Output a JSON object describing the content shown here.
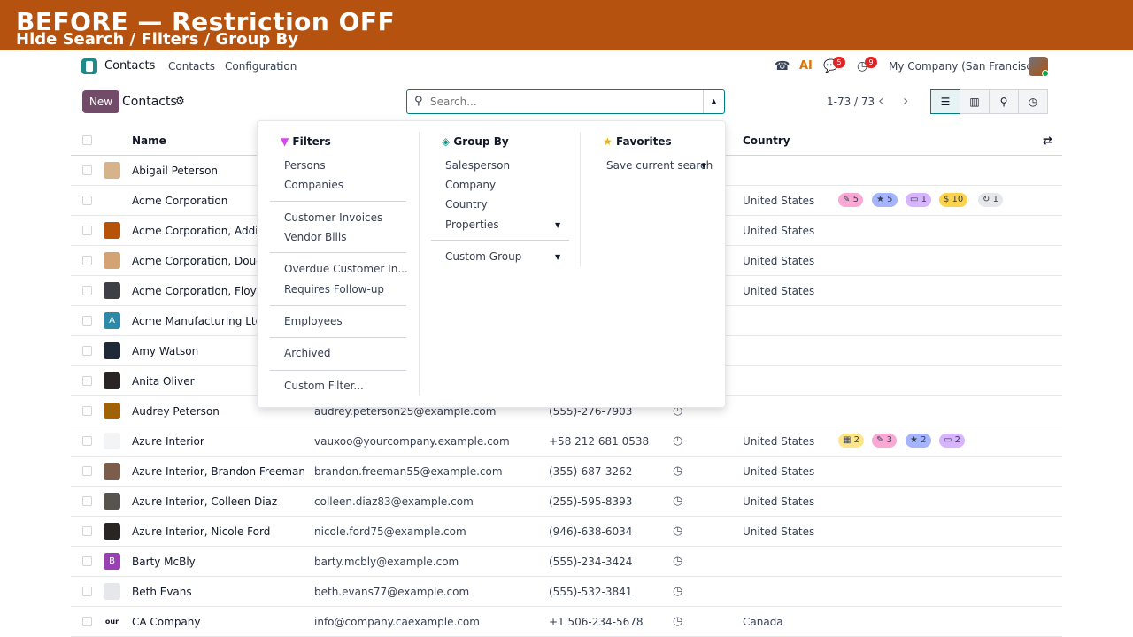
{
  "banner": {
    "title": "BEFORE — Restriction OFF",
    "subtitle": "Hide Search / Filters / Group By"
  },
  "navbar": {
    "app_name": "Contacts",
    "menu": [
      "Contacts",
      "Configuration"
    ],
    "messages_count": "5",
    "activities_count": "9",
    "company": "My Company (San Francisco)"
  },
  "control": {
    "new_label": "New",
    "title": "Contacts",
    "search_placeholder": "Search...",
    "pager": "1-73 / 73"
  },
  "table": {
    "headers": {
      "name": "Name",
      "country": "Country"
    },
    "rows": [
      {
        "name": "Abigail Peterson",
        "email": "",
        "phone": "",
        "country": "",
        "av_color": "#d6b38a"
      },
      {
        "name": "Acme Corporation",
        "email": "",
        "phone": "",
        "country": "United States",
        "av_color": "#ffffff"
      },
      {
        "name": "Acme Corporation, Addison",
        "email": "",
        "phone": "",
        "country": "United States",
        "av_color": "#b45309"
      },
      {
        "name": "Acme Corporation, Douglas",
        "email": "",
        "phone": "",
        "country": "United States",
        "av_color": "#d4a373"
      },
      {
        "name": "Acme Corporation, Floyd St",
        "email": "",
        "phone": "",
        "country": "United States",
        "av_color": "#3f3f46"
      },
      {
        "name": "Acme Manufacturing Ltd",
        "email": "",
        "phone": "",
        "country": "",
        "av_color": "#2c8aa8",
        "initial": "A"
      },
      {
        "name": "Amy Watson",
        "email": "",
        "phone": "",
        "country": "",
        "av_color": "#1f2937"
      },
      {
        "name": "Anita Oliver",
        "email": "",
        "phone": "",
        "country": "",
        "av_color": "#292524"
      },
      {
        "name": "Audrey Peterson",
        "email": "audrey.peterson25@example.com",
        "phone": "(555)-276-7903",
        "country": "",
        "av_color": "#a16207"
      },
      {
        "name": "Azure Interior",
        "email": "vauxoo@yourcompany.example.com",
        "phone": "+58 212 681 0538",
        "country": "United States",
        "av_color": "#f3f4f6"
      },
      {
        "name": "Azure Interior, Brandon Freeman",
        "email": "brandon.freeman55@example.com",
        "phone": "(355)-687-3262",
        "country": "United States",
        "av_color": "#7c5c4a"
      },
      {
        "name": "Azure Interior, Colleen Diaz",
        "email": "colleen.diaz83@example.com",
        "phone": "(255)-595-8393",
        "country": "United States",
        "av_color": "#57534e"
      },
      {
        "name": "Azure Interior, Nicole Ford",
        "email": "nicole.ford75@example.com",
        "phone": "(946)-638-6034",
        "country": "United States",
        "av_color": "#292524"
      },
      {
        "name": "Barty McBly",
        "email": "barty.mcbly@example.com",
        "phone": "(555)-234-3424",
        "country": "",
        "av_color": "#9b3fb5",
        "initial": "B"
      },
      {
        "name": "Beth Evans",
        "email": "beth.evans77@example.com",
        "phone": "(555)-532-3841",
        "country": "",
        "av_color": "#e5e7eb"
      },
      {
        "name": "CA Company",
        "email": "info@company.caexample.com",
        "phone": "+1 506-234-5678",
        "country": "Canada",
        "av_color": "#ffffff",
        "initial": "our l"
      }
    ],
    "acme_tags": [
      "5",
      "5",
      "1",
      "$ 10",
      "1"
    ],
    "azure_tags": [
      "2",
      "3",
      "2",
      "2"
    ]
  },
  "dropdown": {
    "filters_title": "Filters",
    "filters": [
      "Persons",
      "Companies",
      "Customer Invoices",
      "Vendor Bills",
      "Overdue Customer In...",
      "Requires Follow-up",
      "Employees",
      "Archived",
      "Custom Filter..."
    ],
    "groupby_title": "Group By",
    "groupby": [
      "Salesperson",
      "Company",
      "Country",
      "Properties",
      "Custom Group"
    ],
    "favorites_title": "Favorites",
    "favorites": [
      "Save current search"
    ]
  },
  "colors": {
    "banner": "#b5520f",
    "primary": "#714b67",
    "accent": "#017e84"
  }
}
